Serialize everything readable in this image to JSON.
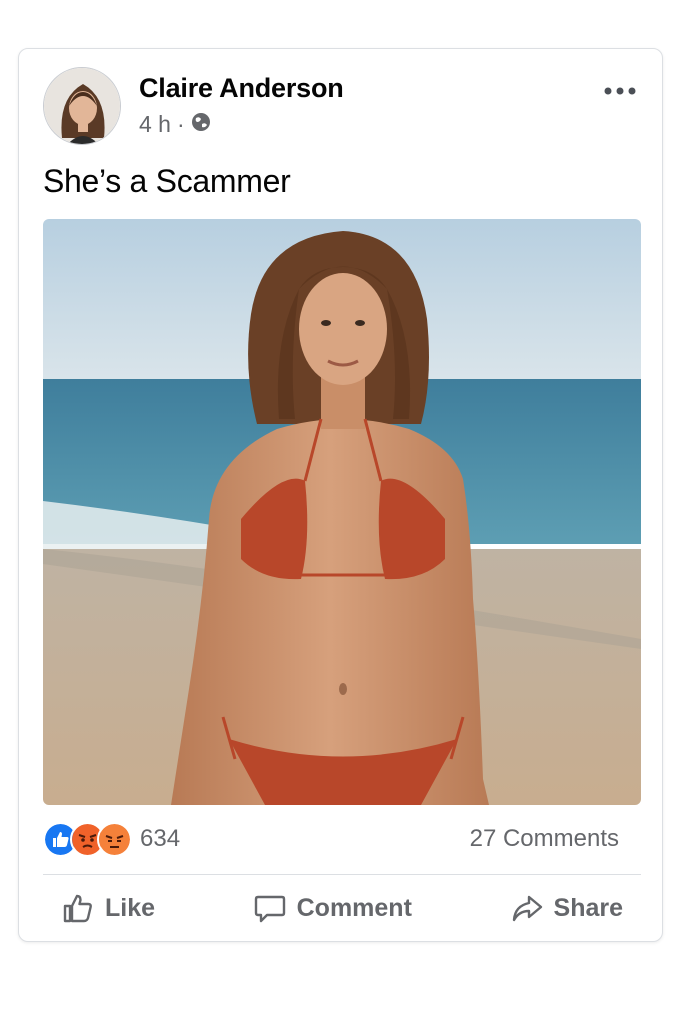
{
  "post": {
    "author": "Claire Anderson",
    "time": "4 h",
    "separator": "·",
    "privacy_icon": "globe-icon",
    "text": "She’s a Scammer",
    "more_icon": "more-dots-icon"
  },
  "stats": {
    "reactions": [
      "like-reaction-icon",
      "angry-reaction-icon",
      "angry-reaction-icon"
    ],
    "reaction_count": "634",
    "comments": "27 Comments"
  },
  "actions": {
    "like": "Like",
    "comment": "Comment",
    "share": "Share"
  },
  "colors": {
    "like_blue": "#1877f2",
    "angry_orange": "#f0622a",
    "secondary_text": "#65676b"
  }
}
